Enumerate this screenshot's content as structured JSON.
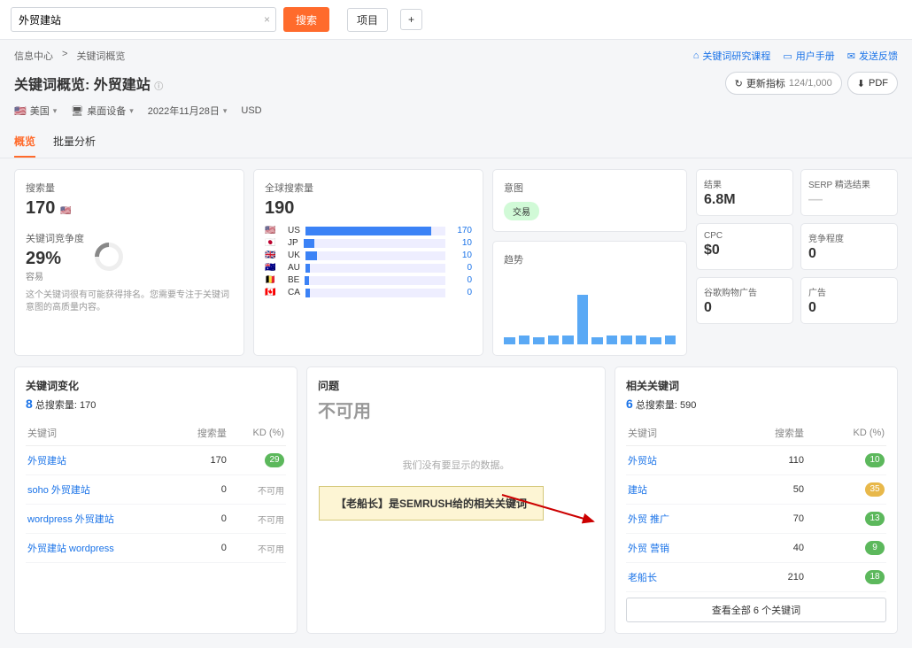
{
  "search": {
    "value": "外贸建站",
    "button": "搜索",
    "project": "项目"
  },
  "breadcrumb": {
    "root": "信息中心",
    "sep": ">",
    "page": "关键词概览"
  },
  "headerLinks": {
    "course": "关键词研究课程",
    "manual": "用户手册",
    "feedback": "发送反馈"
  },
  "title": "关键词概览: 外贸建站",
  "refresh": "更新指标",
  "counter": "124/1,000",
  "pdf": "PDF",
  "filters": {
    "country": "美国",
    "device": "桌面设备",
    "date": "2022年11月28日",
    "currency": "USD"
  },
  "tabs": {
    "overview": "概览",
    "bulk": "批量分析"
  },
  "volume": {
    "label": "搜索量",
    "value": "170"
  },
  "difficulty": {
    "label": "关键词竞争度",
    "value": "29%",
    "tag": "容易",
    "note": "这个关键词很有可能获得排名。您需要专注于关键词意图的高质量内容。"
  },
  "global": {
    "label": "全球搜索量",
    "value": "190",
    "rows": [
      {
        "flag": "🇺🇸",
        "code": "US",
        "val": 170,
        "pct": 90
      },
      {
        "flag": "🇯🇵",
        "code": "JP",
        "val": 10,
        "pct": 8
      },
      {
        "flag": "🇬🇧",
        "code": "UK",
        "val": 10,
        "pct": 8
      },
      {
        "flag": "🇦🇺",
        "code": "AU",
        "val": 0,
        "pct": 3
      },
      {
        "flag": "🇧🇪",
        "code": "BE",
        "val": 0,
        "pct": 3
      },
      {
        "flag": "🇨🇦",
        "code": "CA",
        "val": 0,
        "pct": 3
      }
    ]
  },
  "intent": {
    "label": "意图",
    "value": "交易"
  },
  "trend": {
    "label": "趋势",
    "bars": [
      10,
      12,
      10,
      12,
      12,
      70,
      10,
      12,
      12,
      12,
      10,
      12
    ]
  },
  "results": {
    "label": "结果",
    "value": "6.8M"
  },
  "serp": {
    "label": "SERP 精选结果",
    "value": ""
  },
  "cpc": {
    "label": "CPC",
    "value": "$0"
  },
  "competition": {
    "label": "竞争程度",
    "value": "0"
  },
  "shopping": {
    "label": "谷歌购物广告",
    "value": "0"
  },
  "ads": {
    "label": "广告",
    "value": "0"
  },
  "variations": {
    "title": "关键词变化",
    "total_label": "总搜索量:",
    "total": "170",
    "count": "8",
    "cols": {
      "kw": "关键词",
      "vol": "搜索量",
      "kd": "KD (%)"
    },
    "rows": [
      {
        "kw": "外贸建站",
        "vol": 170,
        "kd": "29",
        "kdclass": "g"
      },
      {
        "kw": "soho 外贸建站",
        "vol": 0,
        "kd": "不可用",
        "kdclass": ""
      },
      {
        "kw": "wordpress 外贸建站",
        "vol": 0,
        "kd": "不可用",
        "kdclass": ""
      },
      {
        "kw": "外贸建站 wordpress",
        "vol": 0,
        "kd": "不可用",
        "kdclass": ""
      }
    ]
  },
  "questions": {
    "title": "问题",
    "value": "不可用",
    "nodata": "我们没有要显示的数据。"
  },
  "related": {
    "title": "相关关键词",
    "total_label": "总搜索量:",
    "total": "590",
    "count": "6",
    "cols": {
      "kw": "关键词",
      "vol": "搜索量",
      "kd": "KD (%)"
    },
    "rows": [
      {
        "kw": "外贸站",
        "vol": 110,
        "kd": "10",
        "kdclass": "g"
      },
      {
        "kw": "建站",
        "vol": 50,
        "kd": "35",
        "kdclass": "y"
      },
      {
        "kw": "外贸 推广",
        "vol": 70,
        "kd": "13",
        "kdclass": "g"
      },
      {
        "kw": "外贸 营销",
        "vol": 40,
        "kd": "9",
        "kdclass": "g"
      },
      {
        "kw": "老船长",
        "vol": 210,
        "kd": "18",
        "kdclass": "g"
      }
    ],
    "viewall": "查看全部 6 个关键词"
  },
  "callout": "【老船长】是SEMRUSH给的相关关键词"
}
